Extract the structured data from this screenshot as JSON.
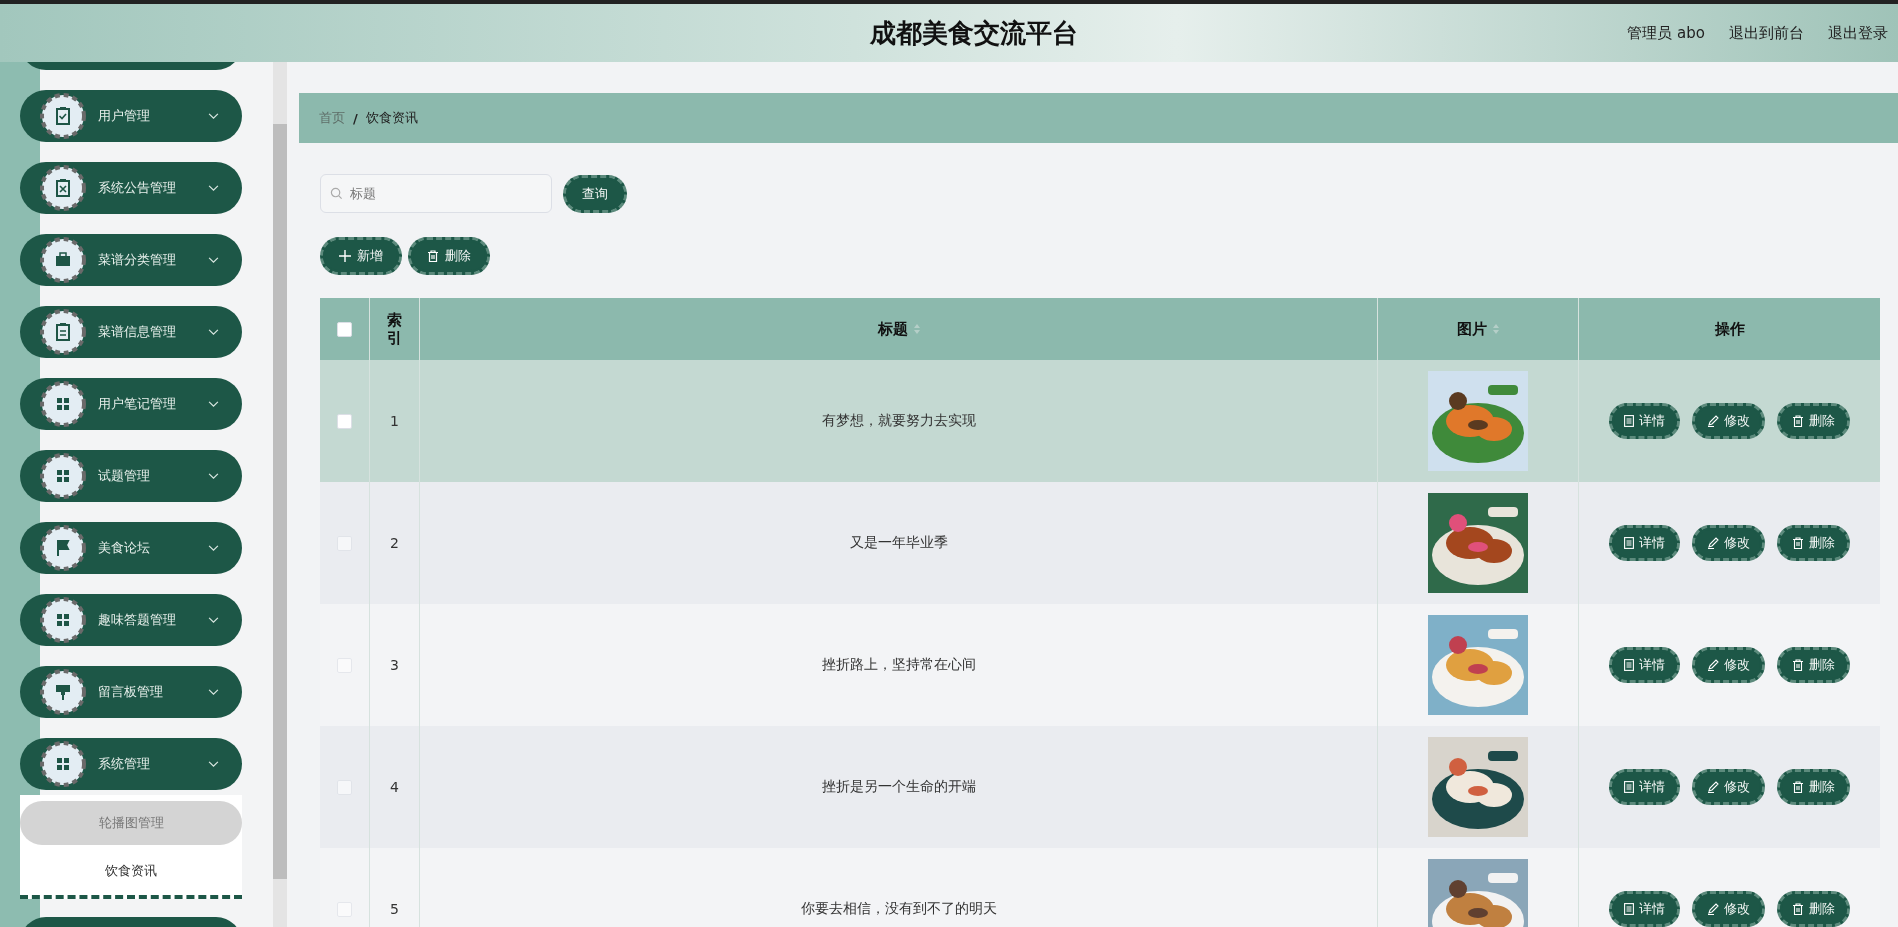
{
  "header": {
    "title": "成都美食交流平台",
    "user": "管理员 abo",
    "links": [
      "退出到前台",
      "退出登录"
    ]
  },
  "sidebar": {
    "items": [
      {
        "label": "用户管理"
      },
      {
        "label": "系统公告管理"
      },
      {
        "label": "菜谱分类管理"
      },
      {
        "label": "菜谱信息管理"
      },
      {
        "label": "用户笔记管理"
      },
      {
        "label": "试题管理"
      },
      {
        "label": "美食论坛"
      },
      {
        "label": "趣味答题管理"
      },
      {
        "label": "留言板管理"
      },
      {
        "label": "系统管理",
        "children": [
          {
            "label": "轮播图管理",
            "hovered": true,
            "selected": false
          },
          {
            "label": "饮食资讯",
            "hovered": false,
            "selected": true
          }
        ]
      }
    ]
  },
  "breadcrumb": {
    "separator": "/",
    "items": [
      {
        "label": "首页",
        "current": false
      },
      {
        "label": "饮食资讯",
        "current": true
      }
    ]
  },
  "search": {
    "placeholder": "标题",
    "button": "查询"
  },
  "toolbar": [
    {
      "kind": "add",
      "label": "新增"
    },
    {
      "kind": "delete",
      "label": "删除"
    }
  ],
  "table": {
    "select_all_checked": false,
    "columns": [
      {
        "label": "索引",
        "sortable": false
      },
      {
        "label": "标题",
        "sortable": true
      },
      {
        "label": "图片",
        "sortable": true
      },
      {
        "label": "操作",
        "sortable": false
      }
    ],
    "rows": [
      {
        "checked": false,
        "selected": true,
        "index": "1",
        "title": "有梦想，就要努力去实现",
        "image": {
          "kind": "picture"
        },
        "actions": [
          "详情",
          "修改",
          "删除"
        ]
      },
      {
        "checked": false,
        "selected": false,
        "index": "2",
        "title": "又是一年毕业季",
        "image": {
          "kind": "picture"
        },
        "actions": [
          "详情",
          "修改",
          "删除"
        ]
      },
      {
        "checked": false,
        "selected": false,
        "index": "3",
        "title": "挫折路上，坚持常在心间",
        "image": {
          "kind": "picture"
        },
        "actions": [
          "详情",
          "修改",
          "删除"
        ]
      },
      {
        "checked": false,
        "selected": false,
        "index": "4",
        "title": "挫折是另一个生命的开端",
        "image": {
          "kind": "picture"
        },
        "actions": [
          "详情",
          "修改",
          "删除"
        ]
      },
      {
        "checked": false,
        "selected": false,
        "index": "5",
        "title": "你要去相信，没有到不了的明天",
        "image": {
          "kind": "picture"
        },
        "actions": [
          "详情",
          "修改",
          "删除"
        ]
      }
    ]
  }
}
